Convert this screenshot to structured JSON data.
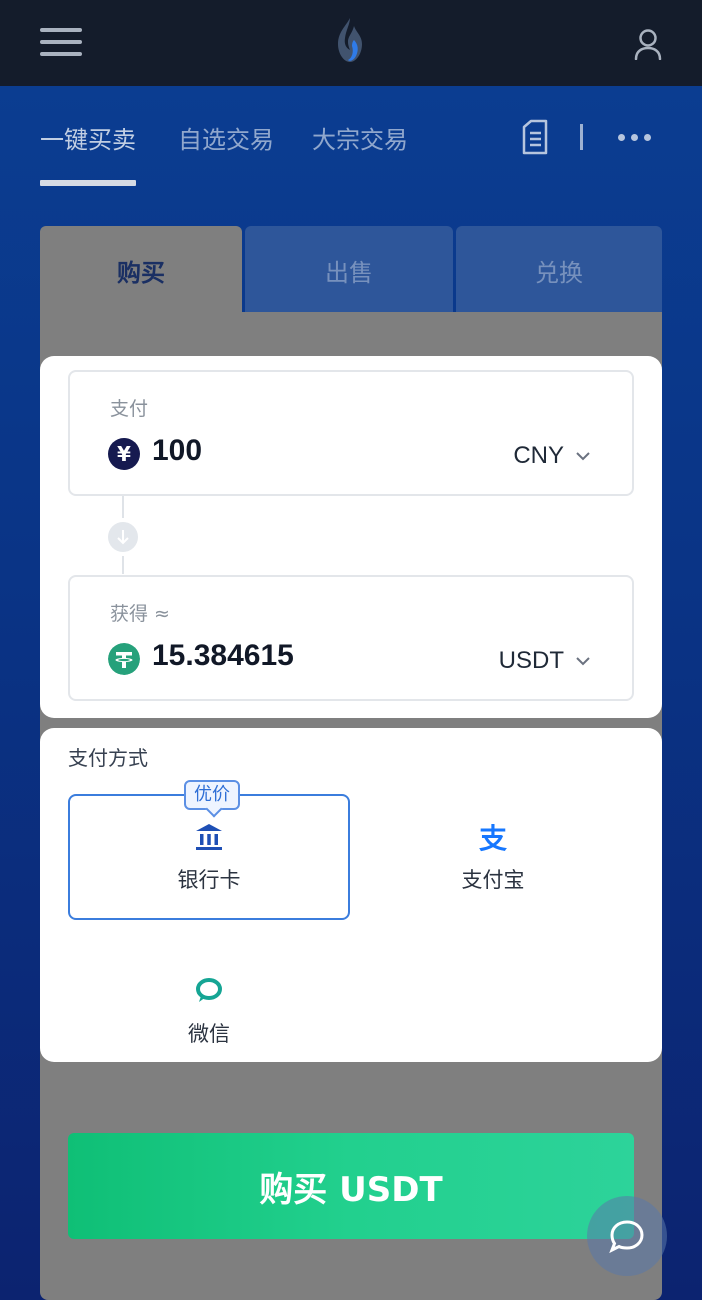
{
  "nav": {
    "tabs": [
      {
        "label": "一键买卖"
      },
      {
        "label": "自选交易"
      },
      {
        "label": "大宗交易"
      }
    ]
  },
  "trade_tabs": [
    {
      "label": "购买"
    },
    {
      "label": "出售"
    },
    {
      "label": "兑换"
    }
  ],
  "pay_field": {
    "label": "支付",
    "value": "100",
    "currency": "CNY",
    "coin_symbol": "¥"
  },
  "receive_field": {
    "label": "获得 ≈",
    "value": "15.384615",
    "currency": "USDT"
  },
  "payment": {
    "title": "支付方式",
    "badge": "优价",
    "options": [
      {
        "label": "银行卡",
        "icon": "bank-icon"
      },
      {
        "label": "支付宝",
        "icon": "alipay-icon",
        "glyph": "支"
      },
      {
        "label": "微信",
        "icon": "wechat-icon"
      }
    ]
  },
  "buy_button": {
    "label": "购买 USDT"
  },
  "colors": {
    "topbar": "#141c2b",
    "accent_blue": "#3b7ddd",
    "buy_green": "#22d08e",
    "tether_green": "#26a17b",
    "cny_navy": "#161a50",
    "wechat_teal": "#15a594",
    "alipay_blue": "#1677ff"
  }
}
